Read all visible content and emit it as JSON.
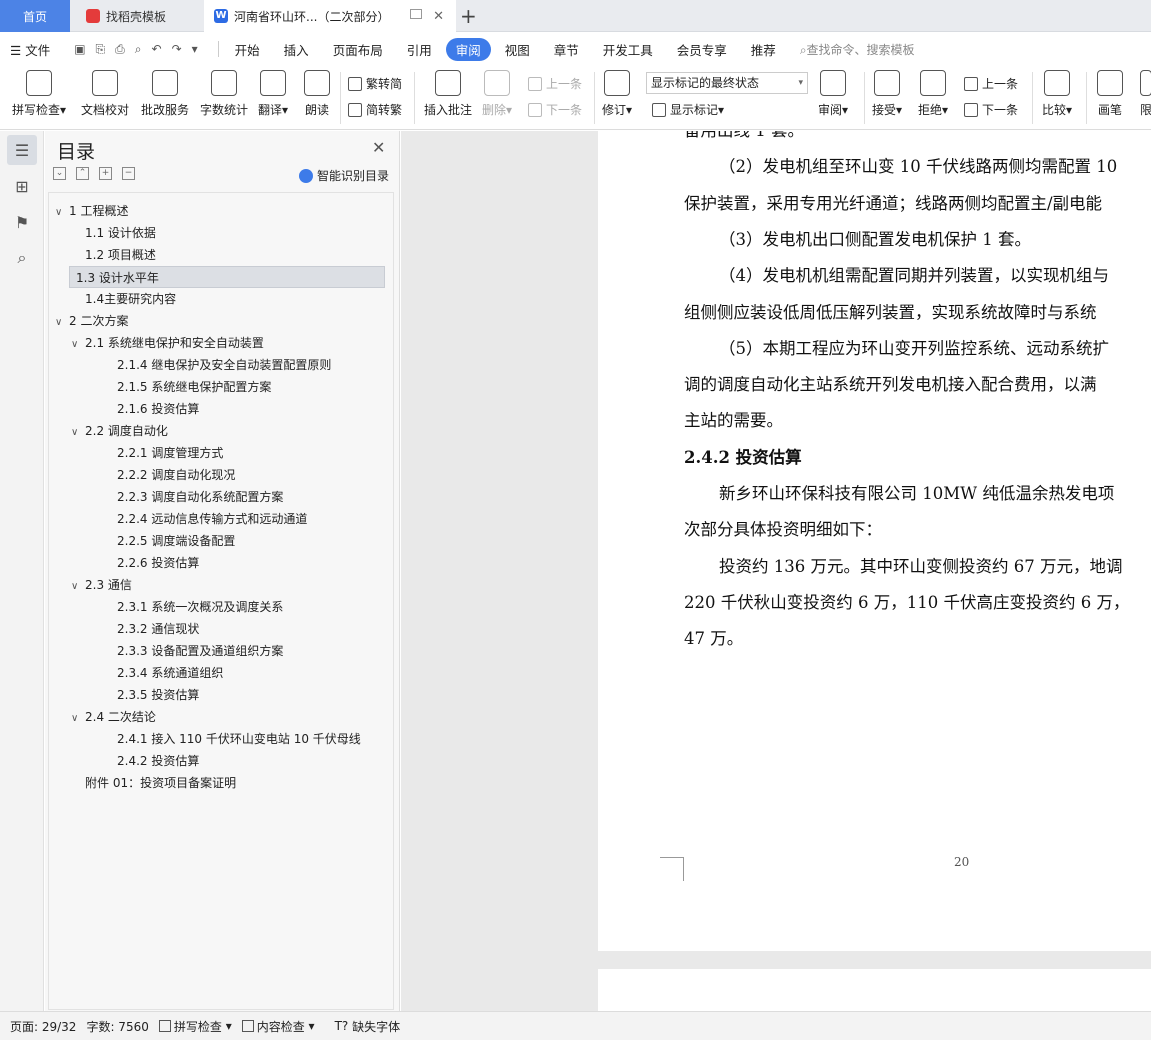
{
  "tabs": {
    "home": "首页",
    "template": "找稻壳模板",
    "document": "河南省环山环...（二次部分）"
  },
  "menu": {
    "file": "文件",
    "items": [
      "开始",
      "插入",
      "页面布局",
      "引用",
      "审阅",
      "视图",
      "章节",
      "开发工具",
      "会员专享",
      "推荐"
    ],
    "active_index": 4,
    "search_placeholder": "查找命令、搜索模板"
  },
  "ribbon": {
    "spell_check": "拼写检查",
    "doc_proof": "文档校对",
    "review_service": "批改服务",
    "word_count": "字数统计",
    "translate": "翻译",
    "read_aloud": "朗读",
    "trad_to_simp": "繁转简",
    "simp_to_trad": "简转繁",
    "insert_comment": "插入批注",
    "delete": "删除",
    "prev_comment": "上一条",
    "next_comment": "下一条",
    "revise": "修订",
    "markup_state": "显示标记的最终状态",
    "show_markup": "显示标记",
    "review": "审阅",
    "accept": "接受",
    "reject": "拒绝",
    "prev_change": "上一条",
    "next_change": "下一条",
    "compare": "比较",
    "pen": "画笔",
    "restrict": "限"
  },
  "toc": {
    "title": "目录",
    "smart_recognize": "智能识别目录",
    "items": [
      {
        "text": "1 工程概述",
        "level": 1,
        "expanded": true
      },
      {
        "text": "1.1 设计依据",
        "level": 2
      },
      {
        "text": "1.2 项目概述",
        "level": 2
      },
      {
        "text": "1.3  设计水平年",
        "level": 2,
        "selected": true
      },
      {
        "text": "1.4主要研究内容",
        "level": 2
      },
      {
        "text": "2  二次方案",
        "level": 1,
        "expanded": true
      },
      {
        "text": "2.1  系统继电保护和安全自动装置",
        "level": 2,
        "expanded": true
      },
      {
        "text": "2.1.4 继电保护及安全自动装置配置原则",
        "level": 3
      },
      {
        "text": "2.1.5 系统继电保护配置方案",
        "level": 3
      },
      {
        "text": "2.1.6 投资估算",
        "level": 3
      },
      {
        "text": "2.2 调度自动化",
        "level": 2,
        "expanded": true
      },
      {
        "text": "2.2.1 调度管理方式",
        "level": 3
      },
      {
        "text": "2.2.2 调度自动化现况",
        "level": 3
      },
      {
        "text": "2.2.3 调度自动化系统配置方案",
        "level": 3
      },
      {
        "text": "2.2.4 远动信息传输方式和远动通道",
        "level": 3
      },
      {
        "text": "2.2.5 调度端设备配置",
        "level": 3
      },
      {
        "text": "2.2.6 投资估算",
        "level": 3
      },
      {
        "text": "2.3  通信",
        "level": 2,
        "expanded": true
      },
      {
        "text": "2.3.1 系统一次概况及调度关系",
        "level": 3
      },
      {
        "text": "2.3.2 通信现状",
        "level": 3
      },
      {
        "text": "2.3.3 设备配置及通道组织方案",
        "level": 3
      },
      {
        "text": "2.3.4 系统通道组织",
        "level": 3
      },
      {
        "text": "2.3.5 投资估算",
        "level": 3
      },
      {
        "text": "2.4 二次结论",
        "level": 2,
        "expanded": true
      },
      {
        "text": "2.4.1 接入 110 千伏环山变电站 10 千伏母线",
        "level": 3
      },
      {
        "text": "2.4.2 投资估算",
        "level": 3
      },
      {
        "text": "附件 01：投资项目备案证明",
        "level": 2
      }
    ]
  },
  "document": {
    "lines": [
      {
        "text": "备用出线 1 套。",
        "indent": false,
        "heading": false
      },
      {
        "text": "（2）发电机组至环山变 10 千伏线路两侧均需配置 10",
        "indent": true,
        "heading": false
      },
      {
        "text": "保护装置，采用专用光纤通道；线路两侧均配置主/副电能",
        "indent": false,
        "heading": false
      },
      {
        "text": "（3）发电机出口侧配置发电机保护 1 套。",
        "indent": true,
        "heading": false
      },
      {
        "text": "（4）发电机机组需配置同期并列装置，以实现机组与",
        "indent": true,
        "heading": false
      },
      {
        "text": "组侧侧应装设低周低压解列装置，实现系统故障时与系统",
        "indent": false,
        "heading": false
      },
      {
        "text": "（5）本期工程应为环山变开列监控系统、远动系统扩",
        "indent": true,
        "heading": false
      },
      {
        "text": "调的调度自动化主站系统开列发电机接入配合费用，以满",
        "indent": false,
        "heading": false
      },
      {
        "text": "主站的需要。",
        "indent": false,
        "heading": false
      },
      {
        "text": "2.4.2 投资估算",
        "indent": false,
        "heading": true
      },
      {
        "text": "新乡环山环保科技有限公司 10MW 纯低温余热发电项",
        "indent": true,
        "heading": false
      },
      {
        "text": "次部分具体投资明细如下：",
        "indent": false,
        "heading": false
      },
      {
        "text": "投资约 136 万元。其中环山变侧投资约 67 万元，地调",
        "indent": true,
        "heading": false
      },
      {
        "text": "220 千伏秋山变投资约 6 万，110 千伏高庄变投资约 6 万，",
        "indent": false,
        "heading": false
      },
      {
        "text": "47 万。",
        "indent": false,
        "heading": false
      }
    ],
    "page_number": "20"
  },
  "status": {
    "page": "页面: 29/32",
    "word_count": "字数: 7560",
    "spell_check": "拼写检查",
    "content_check": "内容检查",
    "missing_font": "缺失字体"
  },
  "colors": {
    "accent": "#3d7be9",
    "home_tab": "#4c83e6"
  }
}
